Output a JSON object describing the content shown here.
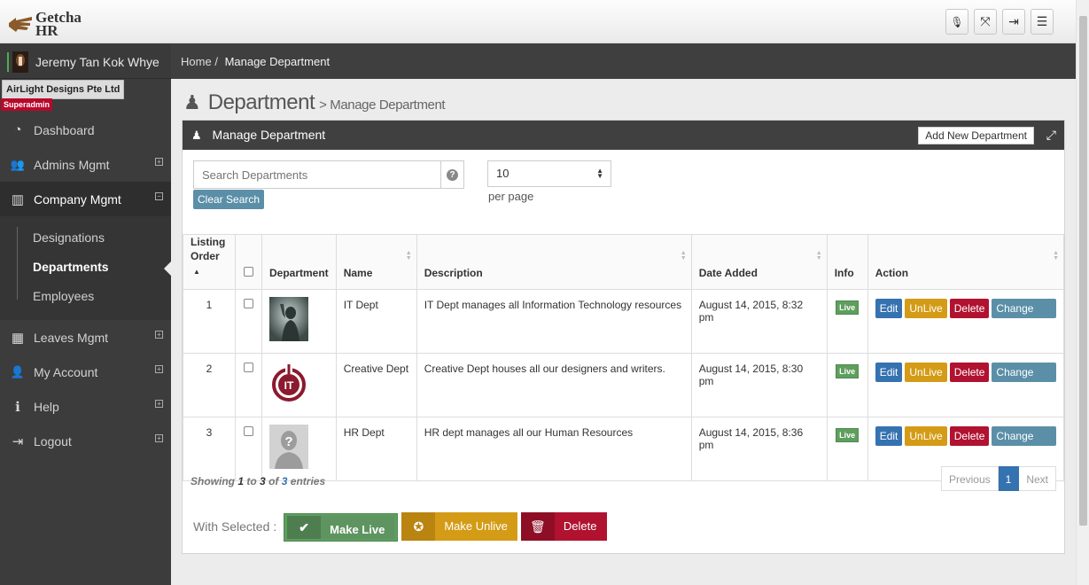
{
  "app": {
    "logo_line1": "Getcha",
    "logo_line2": "HR"
  },
  "header": {
    "buttons": [
      {
        "name": "mic-icon",
        "glyph": "🎙"
      },
      {
        "name": "fullscreen-icon",
        "glyph": "⤧"
      },
      {
        "name": "logout-icon",
        "glyph": "⇥"
      },
      {
        "name": "menu-icon",
        "glyph": "☰"
      }
    ]
  },
  "sidebar": {
    "user_name": "Jeremy Tan Kok Whye",
    "company": "AirLight Designs Pte Ltd",
    "role": "Superadmin",
    "items": [
      {
        "label": "Dashboard",
        "icon": "dashboard-icon",
        "glyph": "◔",
        "expandable": false
      },
      {
        "label": "Admins Mgmt",
        "icon": "users-icon",
        "glyph": "👥",
        "expandable": true,
        "state": "+"
      },
      {
        "label": "Company Mgmt",
        "icon": "building-icon",
        "glyph": "▥",
        "expandable": true,
        "state": "−"
      },
      {
        "label": "Leaves Mgmt",
        "icon": "calendar-icon",
        "glyph": "▦",
        "expandable": true,
        "state": "+"
      },
      {
        "label": "My Account",
        "icon": "user-icon",
        "glyph": "👤",
        "expandable": true,
        "state": "+"
      },
      {
        "label": "Help",
        "icon": "info-icon",
        "glyph": "ℹ",
        "expandable": true,
        "state": "+"
      },
      {
        "label": "Logout",
        "icon": "logout-icon",
        "glyph": "⇥",
        "expandable": true,
        "state": "+"
      }
    ],
    "sub_items": [
      {
        "label": "Designations"
      },
      {
        "label": "Departments"
      },
      {
        "label": "Employees"
      }
    ]
  },
  "breadcrumb": {
    "home": "Home",
    "sep": "/",
    "current": "Manage Department"
  },
  "page": {
    "title": "Department",
    "subtitle": "> Manage Department"
  },
  "panel": {
    "title": "Manage Department",
    "add_button": "Add New Department",
    "search_placeholder": "Search Departments",
    "clear_search": "Clear Search",
    "per_page_value": "10",
    "per_page_label": "per page"
  },
  "table": {
    "headers": {
      "listing": "Listing",
      "order": "Order",
      "department": "Department",
      "name": "Name",
      "description": "Description",
      "date_added": "Date Added",
      "info": "Info",
      "action": "Action"
    },
    "rows": [
      {
        "order": "1",
        "name": "IT Dept",
        "description": "IT Dept manages all Information Technology resources",
        "date": "August 14, 2015, 8:32 pm",
        "info": "Live",
        "image": "silhouette-image"
      },
      {
        "order": "2",
        "name": "Creative Dept",
        "description": "Creative Dept houses all our designers and writers.",
        "date": "August 14, 2015, 8:30 pm",
        "info": "Live",
        "image": "it-logo-image"
      },
      {
        "order": "3",
        "name": "HR Dept",
        "description": "HR dept manages all our Human Resources",
        "date": "August 14, 2015, 8:36 pm",
        "info": "Live",
        "image": "placeholder-avatar-image"
      }
    ],
    "actions": {
      "edit": "Edit",
      "unlive": "UnLive",
      "delete": "Delete",
      "change_order": "Change Order"
    }
  },
  "footer": {
    "showing": "Showing",
    "from": "1",
    "to_word": "to",
    "to": "3",
    "of_word": "of",
    "total": "3",
    "entries": "entries",
    "prev": "Previous",
    "page": "1",
    "next": "Next"
  },
  "bulk": {
    "label": "With Selected :",
    "make_live": "Make Live",
    "make_unlive": "Make Unlive",
    "delete": "Delete"
  },
  "colors": {
    "sidebar_bg": "#3c3c3c",
    "edit": "#3572b0",
    "unlive": "#d49b16",
    "delete": "#b01230",
    "change_order": "#5b8fa8",
    "live_badge": "#5e9e5e"
  }
}
